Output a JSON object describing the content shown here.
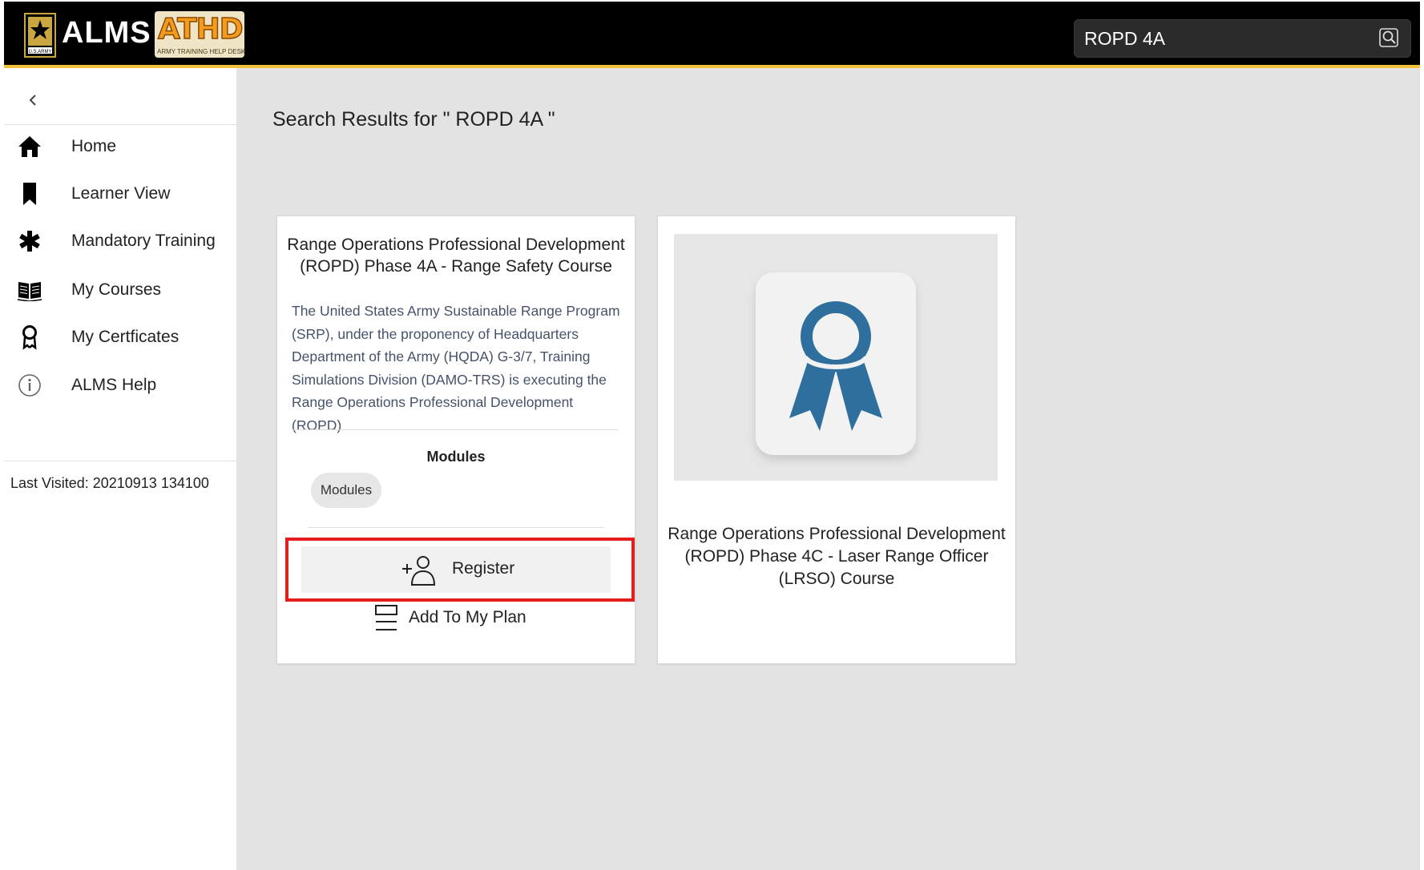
{
  "header": {
    "app_title": "ALMS",
    "athd_logo_text": "ATHD",
    "athd_logo_subtext": "ARMY TRAINING HELP DESK",
    "army_logo_text": "U.S.ARMY",
    "search": {
      "value": "ROPD 4A",
      "icon": "search-icon"
    },
    "colors": {
      "bar": "#000000",
      "accent_line": "#f2c23a"
    }
  },
  "sidebar": {
    "collapse_icon": "chevron-left-icon",
    "items": [
      {
        "label": "Home",
        "icon": "home-icon"
      },
      {
        "label": "Learner View",
        "icon": "bookmark-icon"
      },
      {
        "label": "Mandatory Training",
        "icon": "asterisk-icon"
      },
      {
        "label": "My Courses",
        "icon": "open-book-icon"
      },
      {
        "label": "My Certficates",
        "icon": "award-ribbon-icon"
      },
      {
        "label": "ALMS Help",
        "icon": "info-icon"
      }
    ],
    "last_visited": "Last Visited: 20210913 134100"
  },
  "main": {
    "results_title": "Search Results for \" ROPD 4A \"",
    "cards": [
      {
        "title": "Range Operations Professional Development (ROPD) Phase 4A - Range Safety Course",
        "description": "The United States Army Sustainable Range Program (SRP), under the proponency of Headquarters Department of the Army (HQDA) G-3/7, Training Simulations Division (DAMO-TRS) is executing the Range Operations Professional Development (ROPD)",
        "modules_heading": "Modules",
        "module_chip": "Modules",
        "register_label": "Register",
        "register_icon": "add-user-icon",
        "add_to_plan_label": "Add To My Plan",
        "add_to_plan_icon": "list-icon",
        "highlight_color": "#e41c1c"
      },
      {
        "image_icon": "certificate-ribbon-icon",
        "title": "Range Operations Professional Development (ROPD) Phase 4C - Laser Range Officer (LRSO) Course",
        "badge_color": "#2e6f9e"
      }
    ]
  }
}
